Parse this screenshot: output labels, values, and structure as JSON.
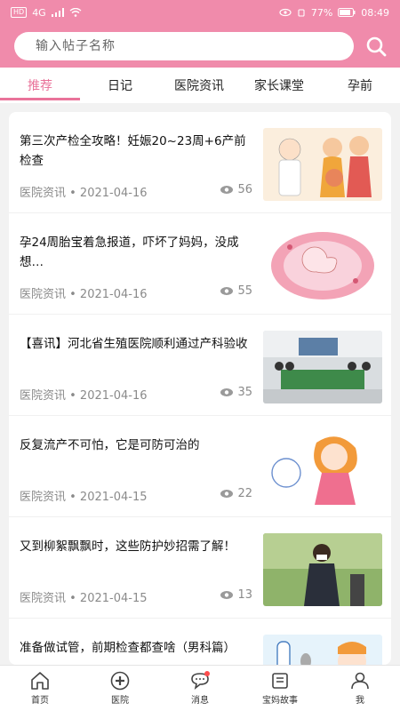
{
  "status_bar": {
    "hd": "HD",
    "signal": "4G",
    "battery": "77%",
    "time": "08:49"
  },
  "search": {
    "placeholder": "输入帖子名称"
  },
  "tabs": [
    {
      "label": "推荐",
      "active": true
    },
    {
      "label": "日记",
      "active": false
    },
    {
      "label": "医院资讯",
      "active": false
    },
    {
      "label": "家长课堂",
      "active": false
    },
    {
      "label": "孕前",
      "active": false
    }
  ],
  "articles": [
    {
      "title": "第三次产检全攻略！妊娠20~23周+6产前检查",
      "meta": "医院资讯 • 2021-04-16",
      "views": "56",
      "thumb": "pregnant-couple-illustration"
    },
    {
      "title": "孕24周胎宝着急报道，吓坏了妈妈，没成想…",
      "meta": "医院资讯 • 2021-04-16",
      "views": "55",
      "thumb": "fetus-in-womb-illustration"
    },
    {
      "title": "【喜讯】河北省生殖医院顺利通过产科验收",
      "meta": "医院资讯 • 2021-04-16",
      "views": "35",
      "thumb": "meeting-room-photo"
    },
    {
      "title": "反复流产不可怕，它是可防可治的",
      "meta": "医院资讯 • 2021-04-15",
      "views": "22",
      "thumb": "pregnant-cartoon-girl"
    },
    {
      "title": "又到柳絮飘飘时，这些防护妙招需了解！",
      "meta": "医院资讯 • 2021-04-15",
      "views": "13",
      "thumb": "woman-with-mask-photo"
    },
    {
      "title": "准备做试管，前期检查都查啥（男科篇）",
      "meta": "",
      "views": "",
      "thumb": "test-tube-illustration"
    }
  ],
  "bottom_nav": [
    {
      "label": "首页",
      "icon": "home-icon"
    },
    {
      "label": "医院",
      "icon": "hospital-icon"
    },
    {
      "label": "消息",
      "icon": "message-icon"
    },
    {
      "label": "宝妈故事",
      "icon": "story-icon"
    },
    {
      "label": "我",
      "icon": "profile-icon"
    }
  ],
  "colors": {
    "brand_pink": "#f08bab",
    "accent": "#e9739a"
  }
}
